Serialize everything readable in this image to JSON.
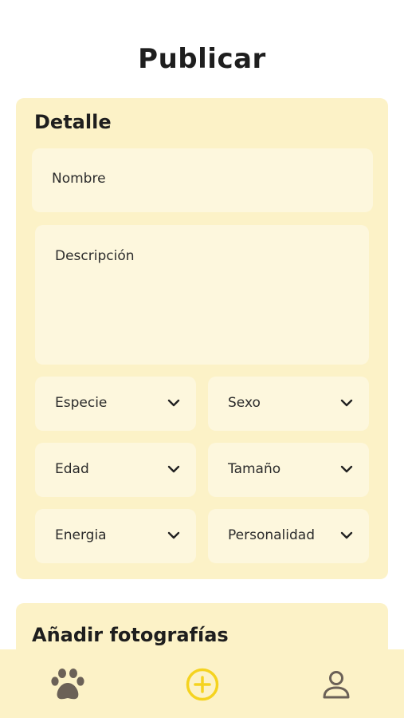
{
  "header": {
    "title": "Publicar"
  },
  "detail": {
    "title": "Detalle",
    "name_placeholder": "Nombre",
    "description_placeholder": "Descripción",
    "selects": {
      "species": "Especie",
      "sex": "Sexo",
      "age": "Edad",
      "size": "Tamaño",
      "energy": "Energia",
      "personality": "Personalidad"
    }
  },
  "photos": {
    "title": "Añadir fotografías"
  },
  "nav": {
    "items": [
      {
        "icon": "paw-icon"
      },
      {
        "icon": "add-circle-icon"
      },
      {
        "icon": "user-icon"
      }
    ]
  },
  "colors": {
    "card_bg": "#fcf2c7",
    "field_bg": "#fdf7dd",
    "accent": "#f5d31f",
    "icon": "#6b6157"
  }
}
